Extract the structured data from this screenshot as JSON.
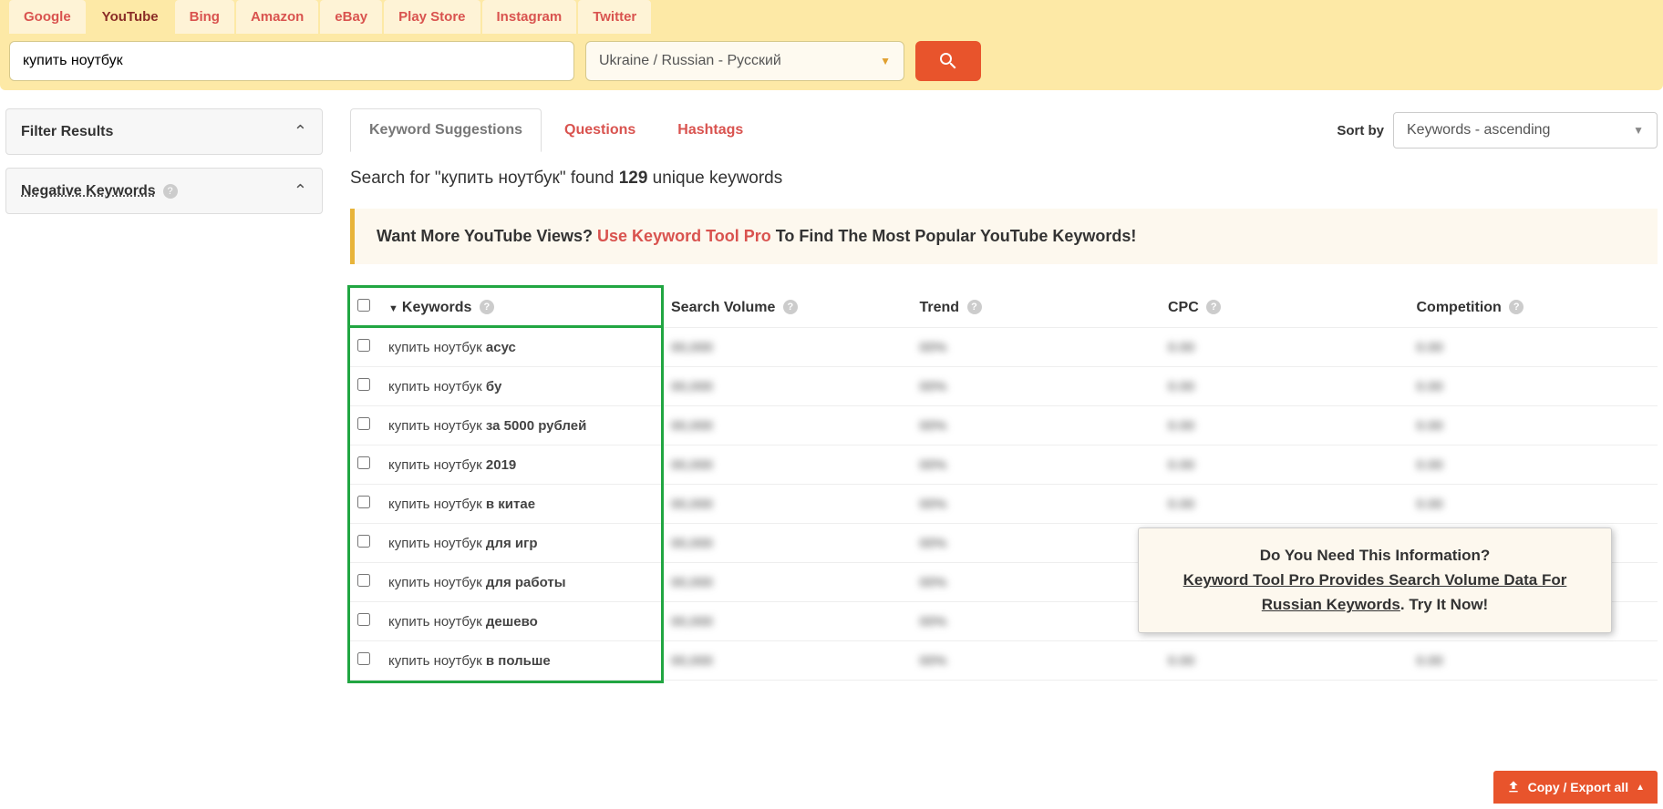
{
  "platformTabs": [
    "Google",
    "YouTube",
    "Bing",
    "Amazon",
    "eBay",
    "Play Store",
    "Instagram",
    "Twitter"
  ],
  "activePlatform": "YouTube",
  "search": {
    "value": "купить ноутбук",
    "locale": "Ukraine / Russian - Русский"
  },
  "filters": {
    "filterResults": "Filter Results",
    "negativeKeywords": "Negative Keywords"
  },
  "secTabs": {
    "suggestions": "Keyword Suggestions",
    "questions": "Questions",
    "hashtags": "Hashtags",
    "active": "suggestions"
  },
  "sort": {
    "label": "Sort by",
    "value": "Keywords - ascending"
  },
  "resultLine": {
    "prefix": "Search for \"",
    "term": "купить ноутбук",
    "mid": "\" found ",
    "count": "129",
    "suffix": " unique keywords"
  },
  "promo": {
    "lead": "Want More YouTube Views? ",
    "link": "Use Keyword Tool Pro",
    "tail": " To Find The Most Popular YouTube Keywords!"
  },
  "tableHead": {
    "keywords": "Keywords",
    "searchVolume": "Search Volume",
    "trend": "Trend",
    "cpc": "CPC",
    "competition": "Competition"
  },
  "rows": [
    {
      "base": "купить ноутбук ",
      "bold": "асус"
    },
    {
      "base": "купить ноутбук ",
      "bold": "бу"
    },
    {
      "base": "купить ноутбук ",
      "bold": "за 5000 рублей"
    },
    {
      "base": "купить ноутбук ",
      "bold": "2019"
    },
    {
      "base": "купить ноутбук ",
      "bold": "в китае"
    },
    {
      "base": "купить ноутбук ",
      "bold": "для игр"
    },
    {
      "base": "купить ноутбук ",
      "bold": "для работы"
    },
    {
      "base": "купить ноутбук ",
      "bold": "дешево"
    },
    {
      "base": "купить ноутбук ",
      "bold": "в польше"
    }
  ],
  "blurPlaceholders": {
    "sv": "00,000",
    "tr": "00%",
    "cpc": "0.00",
    "comp": "0.00"
  },
  "popup": {
    "q": "Do You Need This Information?",
    "link": "Keyword Tool Pro Provides Search Volume Data For Russian Keywords",
    "tail": ". Try It Now!"
  },
  "exportBtn": "Copy / Export all"
}
